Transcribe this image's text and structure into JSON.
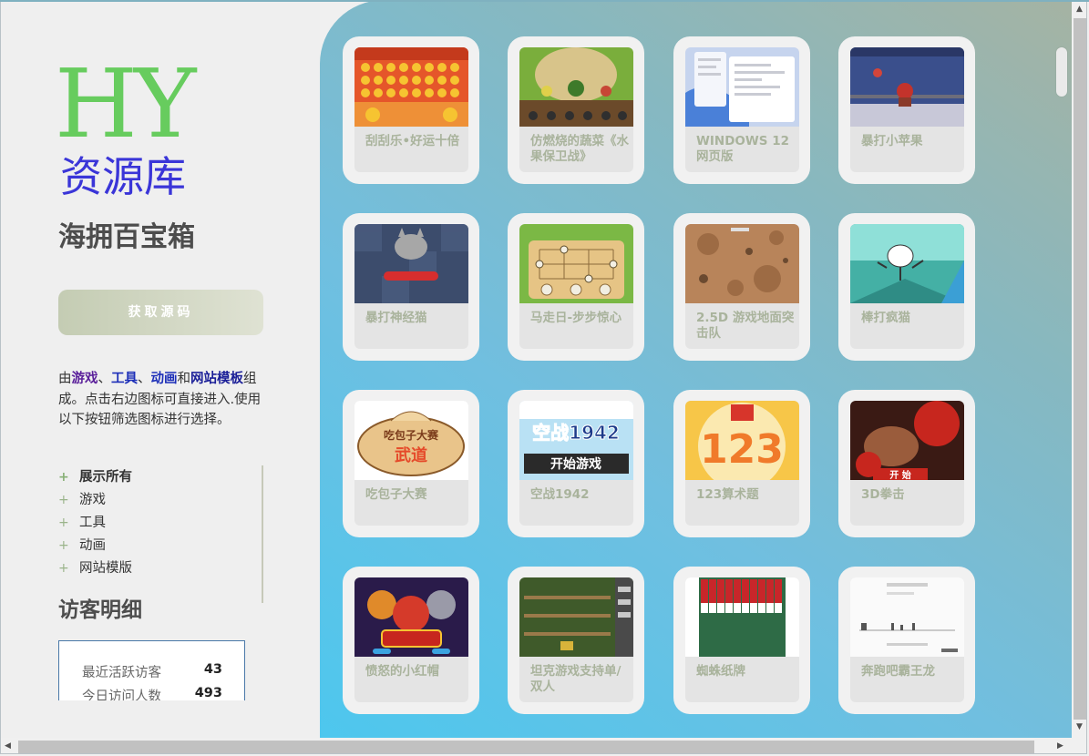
{
  "sidebar": {
    "logo_hy": "HY",
    "logo_lib": "资源库",
    "subtitle": "海拥百宝箱",
    "source_button": "获取源码",
    "description": {
      "p1": "由",
      "games": "游戏",
      "sep1": "、",
      "tools": "工具",
      "sep2": "、",
      "animation": "动画",
      "and": "和",
      "templates": "网站模板",
      "p2": "组成。点击右边图标可直接进入.使用以下按钮筛选图标进行选择。"
    },
    "filters": [
      {
        "label": "展示所有",
        "active": true
      },
      {
        "label": "游戏",
        "active": false
      },
      {
        "label": "工具",
        "active": false
      },
      {
        "label": "动画",
        "active": false
      },
      {
        "label": "网站模版",
        "active": false
      }
    ],
    "visitor_title": "访客明细",
    "stats": [
      {
        "label": "最近活跃访客",
        "value": "43"
      },
      {
        "label": "今日访问人数",
        "value": "493"
      }
    ]
  },
  "cards": [
    {
      "title": "刮刮乐•好运十倍",
      "icon": "scratch-card-thumb"
    },
    {
      "title": "仿燃烧的蔬菜《水果保卫战》",
      "icon": "fruit-defense-thumb"
    },
    {
      "title": "WINDOWS 12 网页版",
      "icon": "windows12-thumb"
    },
    {
      "title": "暴打小苹果",
      "icon": "beat-apple-thumb"
    },
    {
      "title": "暴打神经猫",
      "icon": "beat-cat-thumb"
    },
    {
      "title": "马走日-步步惊心",
      "icon": "knight-move-thumb"
    },
    {
      "title": "2.5D 游戏地面突击队",
      "icon": "ground-assault-thumb"
    },
    {
      "title": "棒打疯猫",
      "icon": "bat-crazy-cat-thumb"
    },
    {
      "title": "吃包子大赛",
      "icon": "bun-contest-thumb",
      "thumb_text": "吃包子大赛"
    },
    {
      "title": "空战1942",
      "icon": "air-war-thumb",
      "thumb_text": "空战1942",
      "thumb_btn": "开始游戏"
    },
    {
      "title": "123算术题",
      "icon": "arithmetic-thumb",
      "thumb_text": "123"
    },
    {
      "title": "3D拳击",
      "icon": "boxing-thumb",
      "thumb_btn": "开 始"
    },
    {
      "title": "愤怒的小红帽",
      "icon": "red-hood-thumb"
    },
    {
      "title": "坦克游戏支持单/双人",
      "icon": "tank-thumb"
    },
    {
      "title": "蜘蛛纸牌",
      "icon": "spider-solitaire-thumb"
    },
    {
      "title": "奔跑吧霸王龙",
      "icon": "trex-runner-thumb"
    }
  ],
  "colors": {
    "logo_green": "#67cc5e",
    "logo_blue": "#3a35d8",
    "card_title": "#a9b39c",
    "accent_plus": "#88b077"
  }
}
